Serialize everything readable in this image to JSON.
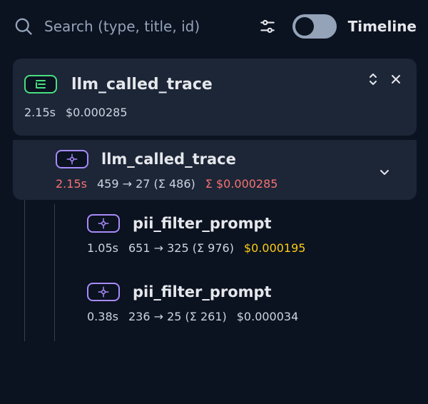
{
  "header": {
    "search": {
      "placeholder": "Search (type, title, id)"
    },
    "toggle": {
      "label": "Timeline",
      "enabled": false
    },
    "icons": {
      "search": "search-icon",
      "filter": "sliders-icon"
    }
  },
  "trace": {
    "title": "llm_called_trace",
    "duration": "2.15s",
    "cost": "$0.000285",
    "icons": {
      "badge": "trace-icon",
      "expand": "chevrons-up-down-icon",
      "collapse": "close-icon"
    }
  },
  "tree": {
    "nodes": [
      {
        "title": "llm_called_trace",
        "duration": "2.15s",
        "tokens": "459 → 27 (Σ 486)",
        "cost": "Σ $0.000285",
        "duration_color": "red",
        "cost_color": "red",
        "icon": "span-icon"
      },
      {
        "title": "pii_filter_prompt",
        "duration": "1.05s",
        "tokens": "651 → 325 (Σ 976)",
        "cost": "$0.000195",
        "duration_color": "",
        "cost_color": "yellow",
        "icon": "span-icon"
      },
      {
        "title": "pii_filter_prompt",
        "duration": "0.38s",
        "tokens": "236 → 25 (Σ 261)",
        "cost": "$0.000034",
        "duration_color": "",
        "cost_color": "",
        "icon": "span-icon"
      }
    ]
  },
  "colors": {
    "background": "#0b1220",
    "card": "#1c2637",
    "text": "#e5e7eb",
    "muted": "#cbd5e1",
    "red": "#f87171",
    "yellow": "#facc15",
    "green": "#4ade80",
    "purple": "#a78bfa"
  }
}
